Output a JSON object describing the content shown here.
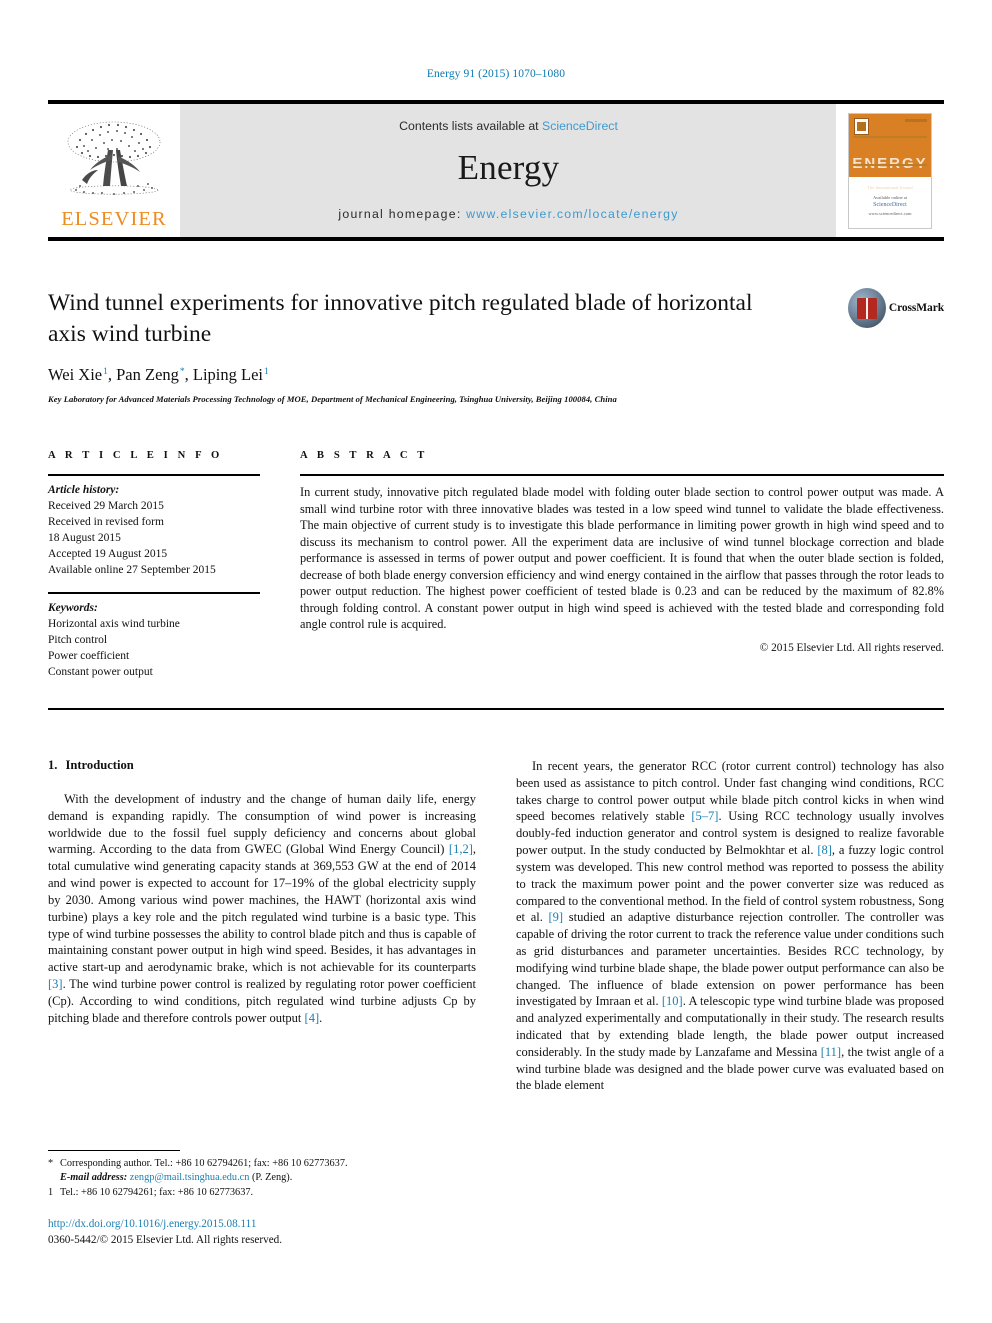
{
  "running_head": "Energy 91 (2015) 1070–1080",
  "masthead": {
    "publisher_name": "ELSEVIER",
    "contents_prefix": "Contents lists available at ",
    "contents_link": "ScienceDirect",
    "journal_title": "Energy",
    "homepage_prefix": "journal homepage: ",
    "homepage_url": "www.elsevier.com/locate/energy",
    "cover": {
      "title": "ENERGY",
      "subtitle": "The International Journal",
      "footer_line1": "Available online at",
      "footer_line2": "ScienceDirect",
      "footer_line3": "www.sciencedirect.com"
    }
  },
  "article": {
    "title": "Wind tunnel experiments for innovative pitch regulated blade of horizontal axis wind turbine",
    "authors": [
      {
        "name": "Wei Xie",
        "mark": "1"
      },
      {
        "name": "Pan Zeng",
        "mark": "*"
      },
      {
        "name": "Liping Lei",
        "mark": "1"
      }
    ],
    "affiliation": "Key Laboratory for Advanced Materials Processing Technology of MOE, Department of Mechanical Engineering, Tsinghua University, Beijing 100084, China",
    "crossmark_label": "CrossMark"
  },
  "article_info": {
    "heading": "A R T I C L E   I N F O",
    "history_label": "Article history:",
    "history": [
      "Received 29 March 2015",
      "Received in revised form",
      "18 August 2015",
      "Accepted 19 August 2015",
      "Available online 27 September 2015"
    ],
    "keywords_label": "Keywords:",
    "keywords": [
      "Horizontal axis wind turbine",
      "Pitch control",
      "Power coefficient",
      "Constant power output"
    ]
  },
  "abstract": {
    "heading": "A B S T R A C T",
    "text": "In current study, innovative pitch regulated blade model with folding outer blade section to control power output was made. A small wind turbine rotor with three innovative blades was tested in a low speed wind tunnel to validate the blade effectiveness. The main objective of current study is to investigate this blade performance in limiting power growth in high wind speed and to discuss its mechanism to control power. All the experiment data are inclusive of wind tunnel blockage correction and blade performance is assessed in terms of power output and power coefficient. It is found that when the outer blade section is folded, decrease of both blade energy conversion efficiency and wind energy contained in the airflow that passes through the rotor leads to power output reduction. The highest power coefficient of tested blade is 0.23 and can be reduced by the maximum of 82.8% through folding control. A constant power output in high wind speed is achieved with the tested blade and corresponding fold angle control rule is acquired.",
    "copyright": "© 2015 Elsevier Ltd. All rights reserved."
  },
  "body": {
    "section_number": "1.",
    "section_title": "Introduction",
    "left_paragraph_1": "With the development of industry and the change of human daily life, energy demand is expanding rapidly. The consumption of wind power is increasing worldwide due to the fossil fuel supply deficiency and concerns about global warming. According to the data from GWEC (Global Wind Energy Council) ",
    "left_ref_1": "[1,2]",
    "left_paragraph_1b": ", total cumulative wind generating capacity stands at 369,553 GW at the end of 2014 and wind power is expected to account for 17–19% of the global electricity supply by 2030. Among various wind power machines, the HAWT (horizontal axis wind turbine) plays a key role and the pitch regulated wind turbine is a basic type. This type of wind turbine possesses the ability to control blade pitch and thus is capable of maintaining constant power output in high wind speed. Besides, it has advantages in active start-up and aerodynamic brake, which is not achievable for its counterparts ",
    "left_ref_2": "[3]",
    "left_paragraph_1c": ". The wind turbine power control is realized by regulating rotor power coefficient (Cp). According to wind conditions, pitch regulated wind turbine adjusts Cp by pitching blade and therefore controls power output ",
    "left_ref_3": "[4]",
    "left_paragraph_1d": ".",
    "right_paragraph_1": "In recent years, the generator RCC (rotor current control) technology has also been used as assistance to pitch control. Under fast changing wind conditions, RCC takes charge to control power output while blade pitch control kicks in when wind speed becomes relatively stable ",
    "right_ref_1": "[5–7]",
    "right_paragraph_1b": ". Using RCC technology usually involves doubly-fed induction generator and control system is designed to realize favorable power output. In the study conducted by Belmokhtar et al. ",
    "right_ref_2": "[8]",
    "right_paragraph_1c": ", a fuzzy logic control system was developed. This new control method was reported to possess the ability to track the maximum power point and the power converter size was reduced as compared to the conventional method. In the field of control system robustness, Song et al. ",
    "right_ref_3": "[9]",
    "right_paragraph_1d": " studied an adaptive disturbance rejection controller. The controller was capable of driving the rotor current to track the reference value under conditions such as grid disturbances and parameter uncertainties. Besides RCC technology, by modifying wind turbine blade shape, the blade power output performance can also be changed. The influence of blade extension on power performance has been investigated by Imraan et al. ",
    "right_ref_4": "[10]",
    "right_paragraph_1e": ". A telescopic type wind turbine blade was proposed and analyzed experimentally and computationally in their study. The research results indicated that by extending blade length, the blade power output increased considerably. In the study made by Lanzafame and Messina ",
    "right_ref_5": "[11]",
    "right_paragraph_1f": ", the twist angle of a wind turbine blade was designed and the blade power curve was evaluated based on the blade element"
  },
  "footnotes": {
    "corresponding_mark": "*",
    "corresponding_text": "Corresponding author. Tel.: +86 10 62794261; fax: +86 10 62773637.",
    "email_label": "E-mail address:",
    "email": "zengp@mail.tsinghua.edu.cn",
    "email_suffix": "(P. Zeng).",
    "note_mark": "1",
    "note_text": "Tel.: +86 10 62794261; fax: +86 10 62773637."
  },
  "footer": {
    "doi": "http://dx.doi.org/10.1016/j.energy.2015.08.111",
    "issn_line": "0360-5442/© 2015 Elsevier Ltd. All rights reserved."
  },
  "colors": {
    "link": "#1a7fb3",
    "sciencedirect": "#3c9ad1",
    "elsevier_orange": "#ED8B20",
    "band_gray": "#e3e3e3"
  }
}
